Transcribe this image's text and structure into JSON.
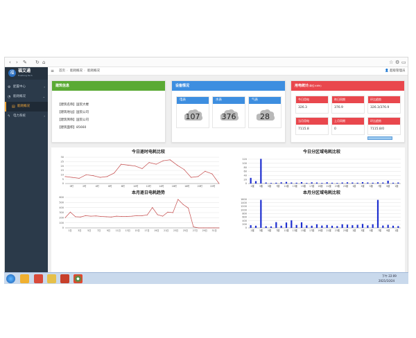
{
  "browser": {
    "icons": [
      "back-icon",
      "forward-icon",
      "edit-icon",
      "refresh-icon",
      "home-icon"
    ],
    "right_icons": [
      "bookmark-icon",
      "gear-icon",
      "window-icon"
    ]
  },
  "app": {
    "logo_text": "福艾通",
    "logo_sub": "Fuaitong Tech"
  },
  "sidebar": {
    "items": [
      {
        "label": "配置中心",
        "icon": "gear-icon"
      },
      {
        "label": "能耗概况",
        "icon": "chart-icon"
      },
      {
        "label": "能耗概况",
        "icon": "doc-icon",
        "active": true
      },
      {
        "label": "电力系统",
        "icon": "power-icon"
      }
    ]
  },
  "topnav": {
    "crumbs": [
      "首页",
      "能耗概况",
      "能耗概况"
    ],
    "user": "超级管理员"
  },
  "building": {
    "title": "建筑信息",
    "lines": [
      "【建筑名称】国贸大楼",
      "【建筑地址】国贸公司",
      "【建筑简称】国贸公司",
      "【建筑面积】85660"
    ]
  },
  "devices": {
    "title": "设备情况",
    "items": [
      {
        "label": "电表",
        "value": "107"
      },
      {
        "label": "水表",
        "value": "376"
      },
      {
        "label": "气表",
        "value": "28"
      }
    ]
  },
  "energy": {
    "title": "用电统计",
    "subtitle": "(单位:kWh)",
    "items": [
      {
        "label": "今日用电",
        "value": "326.3"
      },
      {
        "label": "昨日同期",
        "value": "376.9"
      },
      {
        "label": "环比趋势",
        "value": "326.3/376.9"
      },
      {
        "label": "当月用电",
        "value": "7115.8"
      },
      {
        "label": "上月同期",
        "value": "0"
      },
      {
        "label": "环比趋势",
        "value": "7115.8/0"
      }
    ]
  },
  "colors": {
    "green": "#5aaa34",
    "blue": "#3d8ee0",
    "red": "#e9474d",
    "line": "#c44a4a",
    "bar": "#1e2fd0"
  },
  "chart_data": [
    {
      "type": "line",
      "title": "今日逐时电耗比较",
      "categories": [
        "0时",
        "2时",
        "4时",
        "6时",
        "8时",
        "10时",
        "12时",
        "14时",
        "16时",
        "18时",
        "20时",
        "22时"
      ],
      "x": [
        0,
        1,
        2,
        3,
        4,
        5,
        6,
        7,
        8,
        9,
        10,
        11,
        12,
        13,
        14,
        15,
        16,
        17,
        18,
        19,
        20,
        21,
        22
      ],
      "values": [
        8,
        7,
        6,
        10,
        9,
        7,
        8,
        12,
        22,
        21,
        20,
        17,
        24,
        22,
        26,
        27,
        21,
        16,
        7,
        8,
        14,
        11,
        0
      ],
      "yticks": [
        0,
        5,
        10,
        15,
        20,
        25,
        30
      ],
      "ylim": [
        0,
        30
      ]
    },
    {
      "type": "bar",
      "title": "今日分区域电耗比较",
      "categories": [
        "2楼",
        "3楼",
        "5楼",
        "7楼",
        "11楼",
        "13楼",
        "15楼",
        "17楼",
        "19楼",
        "21楼",
        "23楼",
        "25楼",
        "1楼",
        "3楼",
        "5楼",
        "7楼",
        "9楼",
        "1楼"
      ],
      "values": [
        28,
        12,
        122,
        5,
        3,
        4,
        6,
        8,
        5,
        4,
        7,
        3,
        6,
        5,
        3,
        6,
        4,
        3,
        5,
        6,
        5,
        4,
        7,
        5,
        4,
        6,
        5,
        14,
        4,
        5
      ],
      "yticks": [
        0,
        20,
        40,
        60,
        80,
        100,
        120
      ],
      "ylim": [
        0,
        130
      ]
    },
    {
      "type": "line",
      "title": "本月逐日电耗趋势",
      "categories": [
        "1日",
        "3日",
        "5日",
        "7日",
        "9日",
        "11日",
        "13日",
        "15日",
        "17日",
        "19日",
        "21日",
        "23日",
        "25日",
        "27日",
        "29日",
        "31日"
      ],
      "x": [
        1,
        2,
        3,
        4,
        5,
        6,
        7,
        8,
        9,
        10,
        11,
        12,
        13,
        14,
        15,
        16,
        17,
        18,
        19,
        20,
        21,
        22,
        23,
        24,
        25,
        26,
        27,
        28,
        29,
        30,
        31
      ],
      "values": [
        200,
        310,
        220,
        215,
        240,
        230,
        235,
        225,
        220,
        215,
        230,
        225,
        225,
        230,
        240,
        240,
        255,
        400,
        260,
        230,
        310,
        300,
        560,
        460,
        390,
        20,
        0,
        0,
        0,
        0,
        0
      ],
      "yticks": [
        0,
        100,
        200,
        300,
        400,
        500,
        600
      ],
      "ylim": [
        0,
        600
      ]
    },
    {
      "type": "bar",
      "title": "本月分区域电耗比较",
      "categories": [
        "2楼",
        "3楼",
        "5楼",
        "7楼",
        "11楼",
        "13楼",
        "15楼",
        "17楼",
        "19楼",
        "21楼",
        "23楼",
        "25楼",
        "1楼",
        "3楼",
        "5楼",
        "7楼",
        "9楼",
        "1楼"
      ],
      "values": [
        150,
        120,
        1560,
        90,
        80,
        320,
        120,
        300,
        420,
        160,
        310,
        140,
        120,
        200,
        130,
        160,
        120,
        100,
        200,
        180,
        150,
        170,
        220,
        140,
        200,
        1560,
        130,
        170,
        120,
        100
      ],
      "yticks": [
        0,
        200,
        400,
        600,
        800,
        1000,
        1200,
        1400,
        1600
      ],
      "ylim": [
        0,
        1700
      ]
    }
  ],
  "taskbar": {
    "time": "下午 22:09",
    "date": "2021/10/24",
    "apps": [
      "start",
      "explorer",
      "media",
      "folder",
      "ppt",
      "chrome"
    ]
  }
}
